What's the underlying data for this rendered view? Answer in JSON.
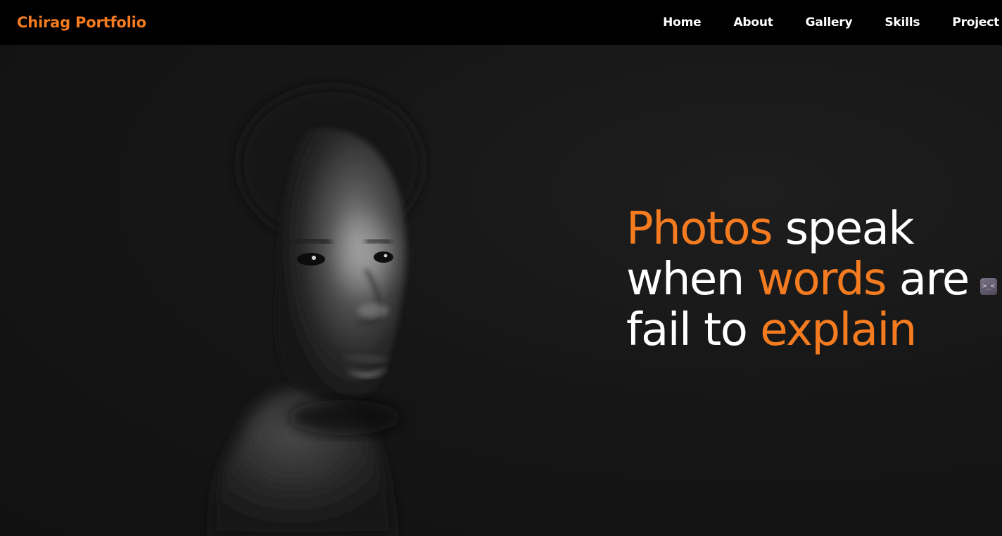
{
  "navbar": {
    "brand": "Chirag Portfolio",
    "links": [
      {
        "label": "Home"
      },
      {
        "label": "About"
      },
      {
        "label": "Gallery"
      },
      {
        "label": "Skills"
      },
      {
        "label": "Project"
      }
    ]
  },
  "hero": {
    "image": "portrait-photo",
    "tagline": {
      "w1": "Photos",
      "w2": "speak",
      "w3": "when",
      "w4": "words",
      "w5": "are",
      "w6": "fail to",
      "w7": "explain"
    }
  },
  "extension_widget": {
    "icon": "extension-face-icon",
    "glyph": ">_<"
  },
  "colors": {
    "accent": "#f47b20",
    "nav_background": "#000000",
    "page_background": "#141414",
    "text": "#ffffff"
  }
}
